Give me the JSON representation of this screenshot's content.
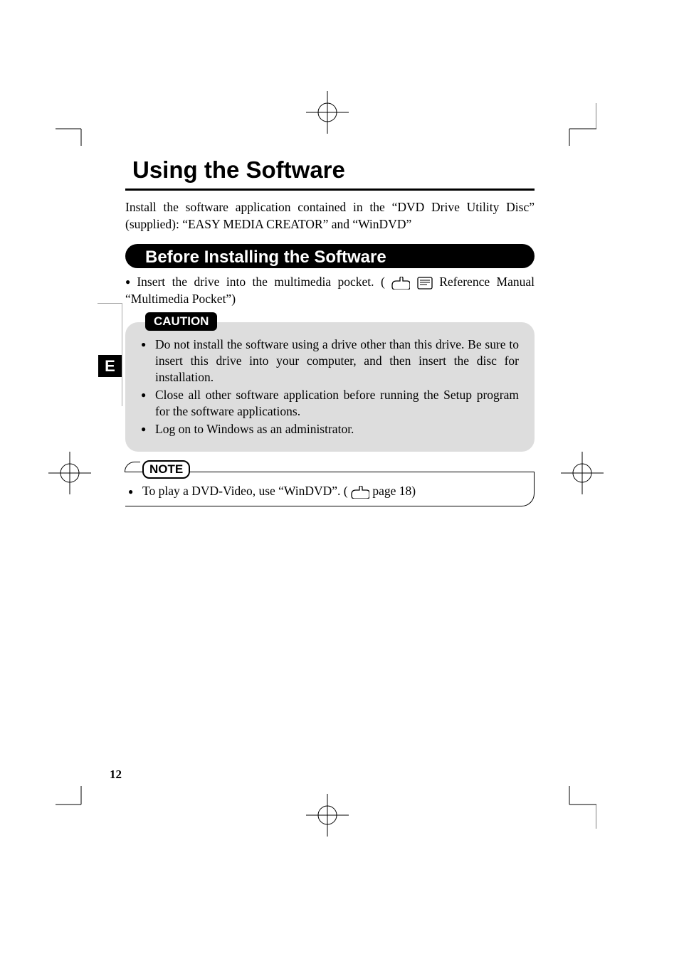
{
  "title": "Using the Software",
  "intro": "Install the software application contained in the “DVD Drive Utility Disc” (supplied): “EASY MEDIA CREATOR” and “WinDVD”",
  "section_header": "Before Installing the Software",
  "insert_drive_pre": "Insert the drive into the multimedia pocket. (",
  "insert_drive_post": " Reference Manual “Multimedia Pocket”)",
  "caution_label": "CAUTION",
  "caution_items": [
    "Do not install the software using a drive other than this drive. Be sure to insert this drive into your computer, and then insert the disc for installation.",
    "Close all other software application before running the Setup program for the software applications.",
    "Log on to Windows as an administrator."
  ],
  "note_label": "NOTE",
  "note_item_pre": "To play a DVD-Video, use “WinDVD”. (",
  "note_item_post": " page 18)",
  "side_tab": "E",
  "page_number": "12"
}
